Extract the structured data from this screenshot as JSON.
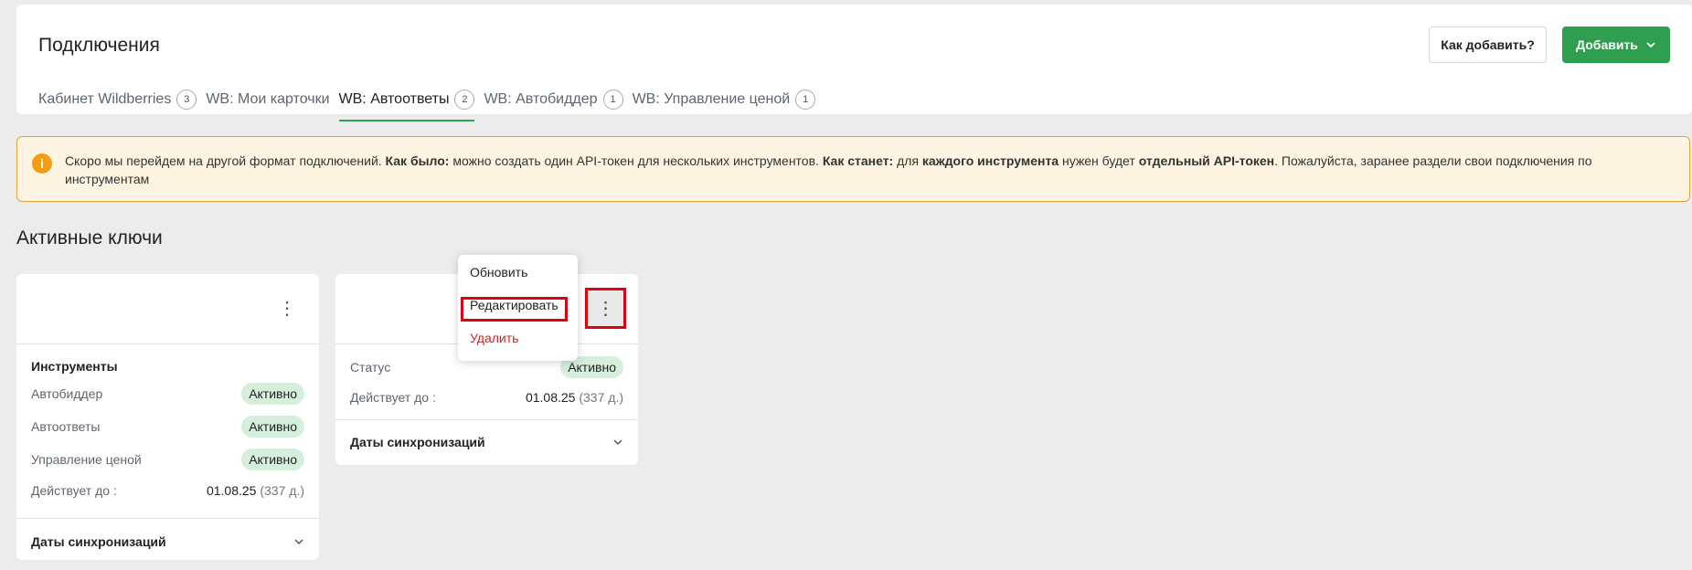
{
  "header": {
    "title": "Подключения",
    "how_to_add": "Как добавить?",
    "add_button": "Добавить"
  },
  "tabs": [
    {
      "label": "Кабинет Wildberries",
      "count": "3",
      "active": false
    },
    {
      "label": "WB: Мои карточки",
      "count": "",
      "active": false
    },
    {
      "label": "WB: Автоответы",
      "count": "2",
      "active": true
    },
    {
      "label": "WB: Автобиддер",
      "count": "1",
      "active": false
    },
    {
      "label": "WB: Управление ценой",
      "count": "1",
      "active": false
    }
  ],
  "notice": {
    "icon": "info-icon",
    "parts": {
      "p1": "Скоро мы перейдем на другой формат подключений. ",
      "b1": "Как было:",
      "p2": " можно создать один API-токен для нескольких инструментов. ",
      "b2": "Как станет:",
      "p3": " для ",
      "b3": "каждого инструмента",
      "p4": " нужен будет ",
      "b4": "отдельный API-токен",
      "p5": ". Пожалуйста, заранее раздели свои подключения по инструментам"
    }
  },
  "section_title": "Активные ключи",
  "card1": {
    "tools_title": "Инструменты",
    "tools": [
      {
        "name": "Автобиддер",
        "status": "Активно"
      },
      {
        "name": "Автоответы",
        "status": "Активно"
      },
      {
        "name": "Управление ценой",
        "status": "Активно"
      }
    ],
    "valid_label": "Действует до :",
    "valid_date": "01.08.25",
    "valid_days": "(337 д.)",
    "sync_label": "Даты синхронизаций"
  },
  "card2": {
    "status_label": "Статус",
    "status_value": "Активно",
    "valid_label": "Действует до :",
    "valid_date": "01.08.25",
    "valid_days": "(337 д.)",
    "sync_label": "Даты синхронизаций"
  },
  "menu": {
    "refresh": "Обновить",
    "edit": "Редактировать",
    "delete": "Удалить"
  },
  "colors": {
    "accent": "#2e9e4f",
    "badge_bg": "#d5efdc",
    "notice_bg": "#fef4e2",
    "notice_border": "#e2a23b",
    "danger": "#c62828"
  }
}
